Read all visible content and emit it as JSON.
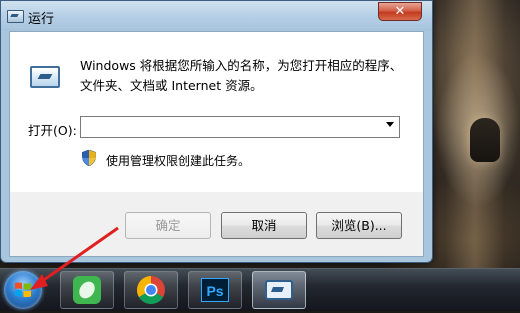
{
  "window": {
    "title": "运行",
    "close_glyph": "✕"
  },
  "dialog": {
    "description_line1": "Windows 将根据您所输入的名称，为您打开相应的程序、",
    "description_line2": "文件夹、文档或 Internet 资源。",
    "open_label": "打开(O):",
    "open_value": "",
    "admin_note": "使用管理权限创建此任务。"
  },
  "buttons": {
    "ok": "确定",
    "cancel": "取消",
    "browse": "浏览(B)..."
  },
  "taskbar": {
    "items": [
      {
        "name": "start",
        "icon": "windows-start-orb"
      },
      {
        "name": "evernote",
        "icon": "evernote-icon"
      },
      {
        "name": "chrome",
        "icon": "chrome-icon"
      },
      {
        "name": "photoshop",
        "icon": "photoshop-icon",
        "label": "Ps"
      },
      {
        "name": "run",
        "icon": "run-dialog-icon"
      }
    ]
  },
  "colors": {
    "accent_red_arrow": "#e02020",
    "close_button": "#c23b1f",
    "window_frame": "#a9c6df"
  }
}
